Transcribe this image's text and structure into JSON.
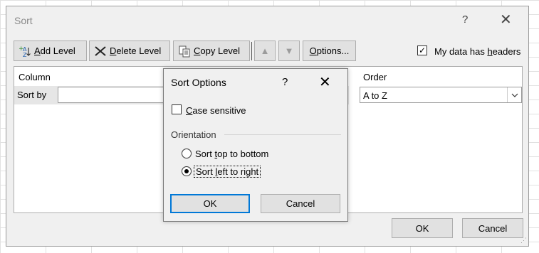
{
  "sort_dialog": {
    "title": "Sort",
    "help_glyph": "?",
    "close_glyph": "✕",
    "toolbar": {
      "add_level": {
        "pre": "",
        "u": "A",
        "post": "dd Level",
        "icon": "add-level-icon"
      },
      "delete_level": {
        "pre": "",
        "u": "D",
        "post": "elete Level",
        "icon": "delete-level-icon"
      },
      "copy_level": {
        "pre": "",
        "u": "C",
        "post": "opy Level",
        "icon": "copy-level-icon"
      },
      "move_up_glyph": "▲",
      "move_down_glyph": "▼",
      "options": {
        "pre": "",
        "u": "O",
        "post": "ptions..."
      }
    },
    "headers_checkbox": {
      "checked": true,
      "mark": "✓",
      "pre": "My data has ",
      "u": "h",
      "post": "eaders"
    },
    "columns": {
      "column": "Column",
      "order": "Order"
    },
    "row": {
      "label": "Sort by",
      "column_value": "",
      "order_value": "A to Z"
    },
    "ok": "OK",
    "cancel": "Cancel"
  },
  "sort_options": {
    "title": "Sort Options",
    "help_glyph": "?",
    "close_glyph": "✕",
    "case_sensitive": {
      "checked": false,
      "u": "C",
      "post": "ase sensitive"
    },
    "orientation_label": "Orientation",
    "options": [
      {
        "pre": "Sort ",
        "u": "t",
        "post": "op to bottom",
        "selected": false
      },
      {
        "pre": "Sort ",
        "u": "l",
        "post": "eft to right",
        "selected": true
      }
    ],
    "ok": "OK",
    "cancel": "Cancel"
  },
  "colors": {
    "accent_focus": "#0078d7",
    "dialog_bg": "#f0f0f0",
    "button_bg": "#e1e1e1"
  }
}
